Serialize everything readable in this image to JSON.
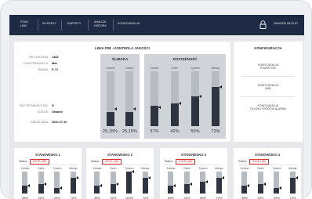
{
  "nav": {
    "item1": [
      "STAN",
      "LINII"
    ],
    "item2": "WYKRESY",
    "item3": "RAPORTY",
    "item4": [
      "ANALIZA",
      "HISTORII"
    ],
    "item5": "KONFIGURACJA",
    "datetime": "20/6/2020 08:22:57"
  },
  "line": {
    "title": "LINIA P08 - KONTROLA JAKOŚCI",
    "info": [
      {
        "label": "NR ZLECENIA:",
        "value": "1483"
      },
      {
        "label": "CZAS PRODUKCJI:",
        "value": "Max"
      },
      {
        "label": "NAZWA:",
        "value": "P-72"
      }
    ],
    "info2": [
      {
        "label": "SALT PRODUKCYJNY:",
        "value": "D"
      },
      {
        "label": "STATUS:",
        "value": "Otwarte"
      },
      {
        "label": "EDIUM DATA:",
        "value": "2020-07-10"
      }
    ],
    "gauges": [
      {
        "title": "ŚLIMOKA",
        "items": [
          {
            "label": "Zmiana",
            "value": 25.15,
            "text": "25,15%",
            "marker": 0.32
          },
          {
            "label": "Dzisiaj",
            "value": 25.15,
            "text": "25,15%",
            "marker": 0.32
          }
        ]
      },
      {
        "title": "DOSTĘPNOŚĆ",
        "items": [
          {
            "label": "Zmiana",
            "value": 37,
            "text": "37%",
            "marker": 0.35
          },
          {
            "label": "Dzień",
            "value": 42,
            "text": "42%",
            "marker": 0.42
          },
          {
            "label": "Tydzień",
            "value": 55,
            "text": "55%",
            "marker": 0.55
          },
          {
            "label": "Miesiąc",
            "value": 72,
            "text": "72%",
            "marker": 0.72
          }
        ]
      }
    ]
  },
  "config": {
    "title": "KONFIGURACJA",
    "items": [
      [
        "KONFIGURACJA",
        "PODUKTÓW"
      ],
      [
        "KONFIGURACJA",
        "WAD"
      ],
      [
        "KONFIGURACJA",
        "CELÓW I PROGÓW ALARMU"
      ]
    ]
  },
  "stations": [
    {
      "title": "STANOWISKO 1",
      "status_label": "Status:",
      "status": "STOP LINII",
      "cols": [
        {
          "label": "Zmiana",
          "value": 36,
          "text": "36%"
        },
        {
          "label": "Dzień",
          "value": 42,
          "text": "42%"
        },
        {
          "label": "Tydzień",
          "value": 25,
          "text": "25%"
        },
        {
          "label": "Miesiąc",
          "value": 72,
          "text": "72%"
        }
      ]
    },
    {
      "title": "STANOWISKO 2",
      "status_label": "Status:",
      "status": "STOP LINII",
      "cols": [
        {
          "label": "Zmiana",
          "value": 36,
          "text": "36%"
        },
        {
          "label": "Dzień",
          "value": 42,
          "text": "42%"
        },
        {
          "label": "Tydzień",
          "value": 100,
          "text": "100%"
        },
        {
          "label": "Miesiąc",
          "value": 72,
          "text": "72%"
        }
      ]
    },
    {
      "title": "STANOWISKO 3",
      "status_label": "Status:",
      "status": "STOP LINII",
      "cols": [
        {
          "label": "Zmiana",
          "value": 36,
          "text": "36%"
        },
        {
          "label": "Dzień",
          "value": 42,
          "text": "42%"
        },
        {
          "label": "Tydzień",
          "value": 55,
          "text": "55%"
        },
        {
          "label": "Miesiąc",
          "value": 72,
          "text": "72%"
        }
      ]
    },
    {
      "title": "STANOWISKO 4",
      "status_label": "Status:",
      "status": "STOP LINII",
      "cols": [
        {
          "label": "Zmiana",
          "value": 36,
          "text": "36%"
        },
        {
          "label": "Dzień",
          "value": 42,
          "text": "42%"
        },
        {
          "label": "Tydzień",
          "value": 25,
          "text": "25%"
        },
        {
          "label": "Miesiąc",
          "value": 72,
          "text": "72%"
        }
      ]
    }
  ],
  "colors": {
    "topbar": "#1f2a44",
    "bar": "#2e3440",
    "alert": "#d93535"
  }
}
